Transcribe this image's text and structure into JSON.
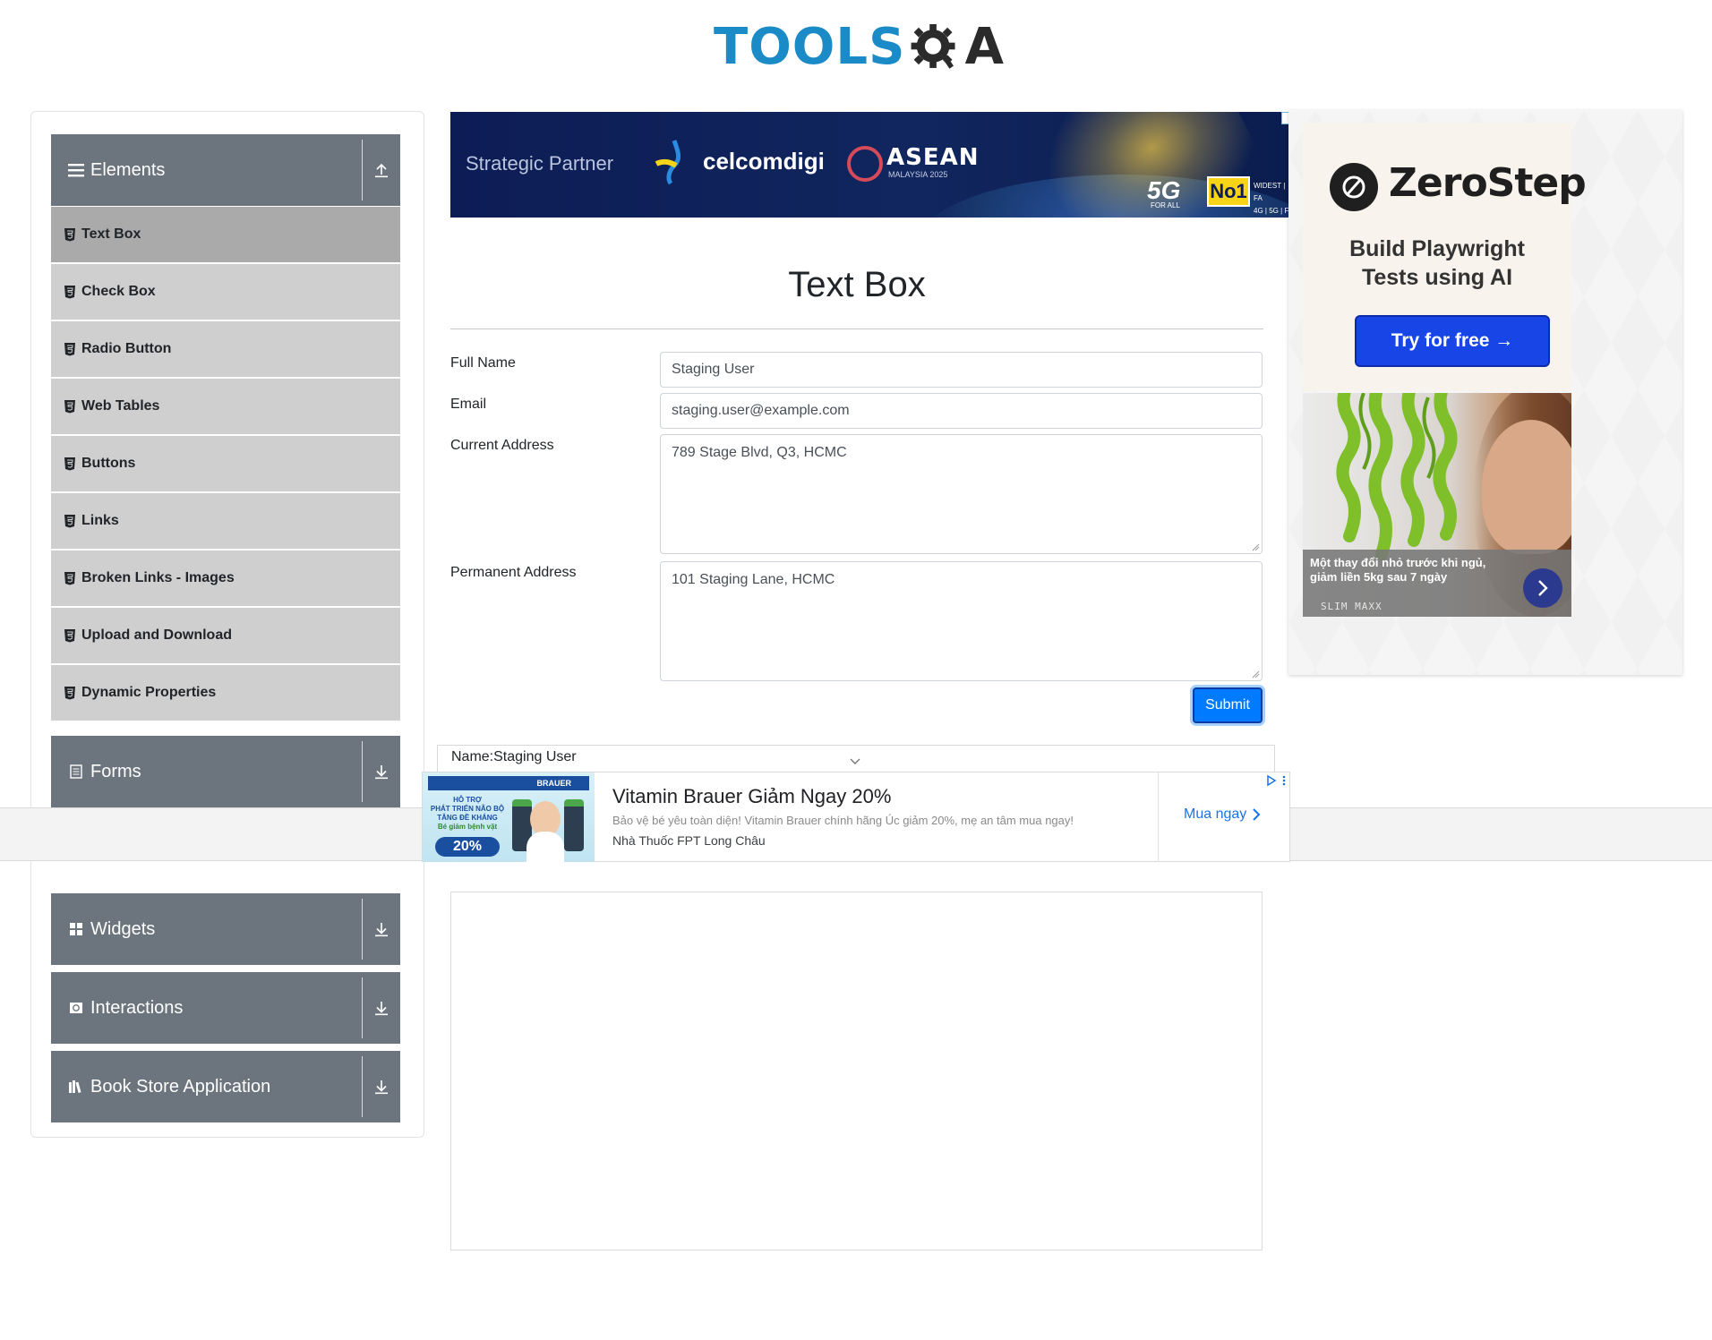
{
  "header": {
    "logo_tools": "TOOLS",
    "logo_qa_letter": "A"
  },
  "sidebar": {
    "groups": [
      {
        "label": "Elements",
        "icon": "hamburger-icon",
        "toggle_icon": "collapse-arrow-icon"
      },
      {
        "label": "Forms",
        "icon": "document-icon",
        "toggle_icon": "expand-arrow-icon"
      },
      {
        "label": "Widgets",
        "icon": "grid-icon",
        "toggle_icon": "expand-arrow-icon"
      },
      {
        "label": "Interactions",
        "icon": "refresh-icon",
        "toggle_icon": "expand-arrow-icon"
      },
      {
        "label": "Book Store Application",
        "icon": "books-icon",
        "toggle_icon": "expand-arrow-icon"
      }
    ],
    "elements_items": [
      {
        "label": "Text Box",
        "active": true
      },
      {
        "label": "Check Box",
        "active": false
      },
      {
        "label": "Radio Button",
        "active": false
      },
      {
        "label": "Web Tables",
        "active": false
      },
      {
        "label": "Buttons",
        "active": false
      },
      {
        "label": "Links",
        "active": false
      },
      {
        "label": "Broken Links - Images",
        "active": false
      },
      {
        "label": "Upload and Download",
        "active": false
      },
      {
        "label": "Dynamic Properties",
        "active": false
      }
    ]
  },
  "banner_ad": {
    "text": "Strategic Partner",
    "brand": "celcomdigi",
    "event": "ASEAN",
    "event_sub": "MALAYSIA 2025",
    "badge_5g": "5G",
    "badge_5g_sub": "FOR ALL",
    "badge_no1": "No1",
    "tags": [
      "WIDEST | FA",
      "4G | 5G | F"
    ]
  },
  "main": {
    "title": "Text Box",
    "fields": {
      "full_name": {
        "label": "Full Name",
        "value": "Staging User"
      },
      "email": {
        "label": "Email",
        "value": "staging.user@example.com"
      },
      "current_address": {
        "label": "Current Address",
        "value": "789 Stage Blvd, Q3, HCMC"
      },
      "permanent_address": {
        "label": "Permanent Address",
        "value": "101 Staging Lane, HCMC"
      }
    },
    "submit_label": "Submit",
    "output": {
      "name_line": "Name:Staging User"
    }
  },
  "sticky_ad": {
    "image": {
      "brand": "BRAUER",
      "lines": [
        "HỖ TRỢ",
        "PHÁT TRIỂN NÃO BỘ",
        "TĂNG ĐỀ KHÁNG",
        "Bé giảm bệnh vặt"
      ],
      "percent": "20%"
    },
    "title": "Vitamin Brauer Giảm Ngay 20%",
    "description": "Bảo vệ bé yêu toàn diện! Vitamin Brauer chính hãng Úc giảm 20%, mẹ an tâm mua ngay!",
    "shop": "Nhà Thuốc FPT Long Châu",
    "cta": "Mua ngay"
  },
  "right_ad": {
    "brand": "ZeroStep",
    "tagline_line1": "Build Playwright",
    "tagline_line2": "Tests using AI",
    "cta": "Try for free →",
    "caption": "Một thay đổi nhỏ trước khi ngủ, giảm liền 5kg sau 7 ngày",
    "sponsor": "SLIM MAXX"
  },
  "colors": {
    "sidebar_header": "#6c757d",
    "sidebar_item": "#cfcfcf",
    "sidebar_item_active": "#aaaaaa",
    "primary_button": "#007bff",
    "logo_blue": "#1a8bc7",
    "zerostep_button": "#1846e6"
  }
}
